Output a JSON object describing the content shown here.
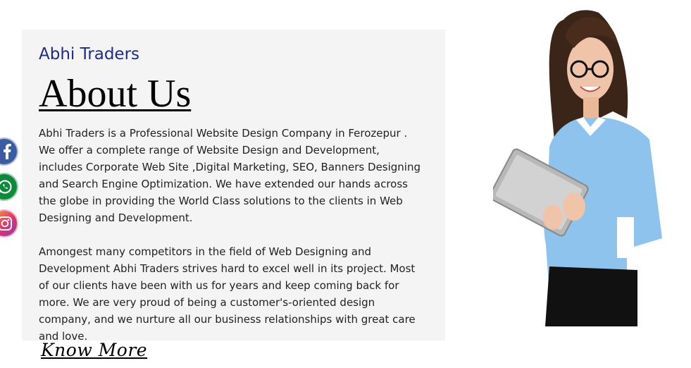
{
  "brand": {
    "name": "Abhi Traders"
  },
  "about": {
    "title": "About Us",
    "paragraphs": [
      "Abhi Traders is a Professional Website Design Company in Ferozepur . We offer a complete range of Website Design and Development, includes Corporate Web Site ,Digital Marketing, SEO, Banners Designing and Search Engine Optimization. We have extended our hands across the globe in providing the World Class solutions to the clients in Web Designing and Development.",
      "Amongest many competitors in the field of Web Designing and Development Abhi Traders strives hard to excel well in its project. Most of our clients have been with us for years and keep coming back for more. We are very proud of being a customer's-oriented design company, and we nurture all our business relationships with great care and love."
    ],
    "cta": "Know More"
  },
  "social": [
    {
      "icon": "facebook-icon",
      "color": "#3b5ba5"
    },
    {
      "icon": "whatsapp-icon",
      "color": "#0e8a3b"
    },
    {
      "icon": "instagram-icon",
      "color": "#e3336b"
    }
  ],
  "colors": {
    "panel": "#f4f4f4",
    "brand": "#1f2a8e",
    "blouse": "#8ec3ee"
  }
}
